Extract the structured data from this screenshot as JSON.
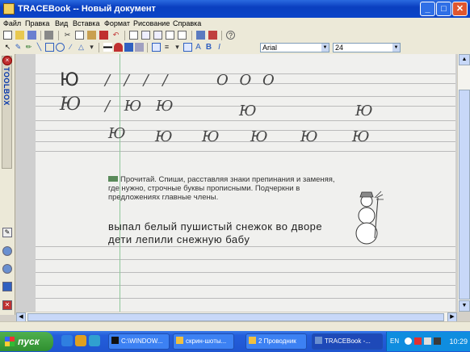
{
  "window": {
    "title": "TRACEBook -- Новый документ",
    "minimize": "_",
    "maximize": "□",
    "close": "✕"
  },
  "menu": [
    "Файл",
    "Правка",
    "Вид",
    "Вставка",
    "Формат",
    "Рисование",
    "Справка"
  ],
  "font": {
    "family": "Arial",
    "size": "24"
  },
  "toolbox": {
    "label": "TOOLBOX"
  },
  "page": {
    "print_letter": "Ю",
    "hw_letter": "Ю",
    "row1_strokes": "/ / / /",
    "row1_circles": "О О О",
    "row2_a": "/ Ю Ю",
    "row2_b": "Ю",
    "row2_c": "Ю",
    "row3": [
      "Ю",
      "Ю",
      "Ю",
      "Ю",
      "Ю",
      "Ю",
      "Ю"
    ],
    "instruction": "Прочитай. Спиши, расставляя знаки препинания и заменяя, где нужно, строчные буквы прописными. Подчеркни в предложениях главные члены.",
    "exercise_line1": "выпал белый пушистый снежок во дворе",
    "exercise_line2": "дети лепили снежную бабу"
  },
  "taskbar": {
    "start": "пуск",
    "tasks": [
      "C:\\WINDOW...",
      "скрин-шоты...",
      "2 Проводник",
      "TRACEBook -..."
    ],
    "lang": "EN",
    "clock": "10:29"
  }
}
